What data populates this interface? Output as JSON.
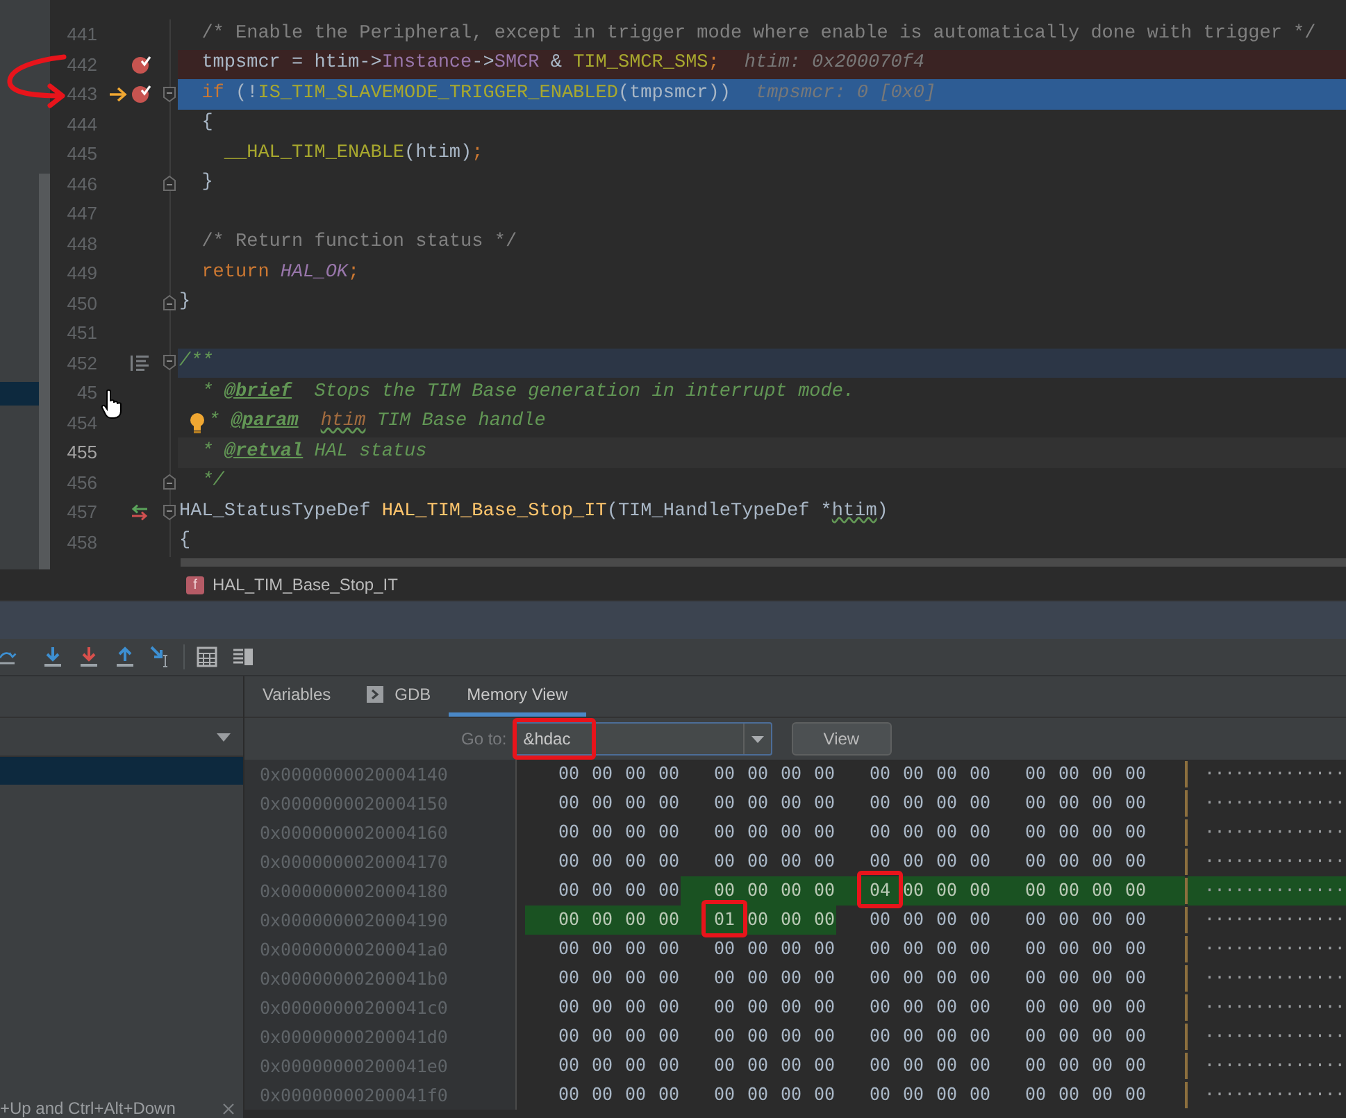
{
  "editor": {
    "annotation_arrow": true,
    "side_panel": {
      "rows": [
        {
          "selected": true
        }
      ]
    },
    "lines": [
      {
        "number": "441",
        "kind": "plain",
        "breakpoint": false,
        "execution": false,
        "highlighted": false,
        "current": false,
        "fold_start": false,
        "fold_end": false,
        "segments": [
          {
            "kind": "comment",
            "text": "  /* Enable the Peripheral, except in trigger mode where enable is automatically done with trigger */"
          }
        ]
      },
      {
        "number": "442",
        "kind": "plain",
        "breakpoint": true,
        "execution": false,
        "highlighted": false,
        "current": false,
        "fold_start": false,
        "fold_end": false,
        "segments": [
          {
            "kind": "plain",
            "text": "  tmpsmcr = htim->"
          },
          {
            "kind": "field",
            "text": "Instance"
          },
          {
            "kind": "plain",
            "text": "->"
          },
          {
            "kind": "field",
            "text": "SMCR"
          },
          {
            "kind": "plain",
            "text": " & "
          },
          {
            "kind": "macro",
            "text": "TIM_SMCR_SMS"
          },
          {
            "kind": "keyword",
            "text": ";"
          }
        ],
        "hint": "htim: 0x200070f4"
      },
      {
        "number": "443",
        "kind": "plain",
        "breakpoint": true,
        "execution": true,
        "highlighted": false,
        "current": false,
        "fold_start": true,
        "fold_end": false,
        "segments": [
          {
            "kind": "keyword",
            "text": "  if"
          },
          {
            "kind": "plain",
            "text": " (!"
          },
          {
            "kind": "macro",
            "text": "IS_TIM_SLAVEMODE_TRIGGER_ENABLED"
          },
          {
            "kind": "plain",
            "text": "(tmpsmcr))"
          }
        ],
        "hint": "tmpsmcr: 0 [0x0]"
      },
      {
        "number": "444",
        "kind": "plain",
        "breakpoint": false,
        "execution": false,
        "highlighted": false,
        "current": false,
        "fold_start": false,
        "fold_end": false,
        "segments": [
          {
            "kind": "plain",
            "text": "  {"
          }
        ]
      },
      {
        "number": "445",
        "kind": "plain",
        "breakpoint": false,
        "execution": false,
        "highlighted": false,
        "current": false,
        "fold_start": false,
        "fold_end": false,
        "segments": [
          {
            "kind": "macro",
            "text": "    __HAL_TIM_ENABLE"
          },
          {
            "kind": "plain",
            "text": "(htim)"
          },
          {
            "kind": "keyword",
            "text": ";"
          }
        ]
      },
      {
        "number": "446",
        "kind": "plain",
        "breakpoint": false,
        "execution": false,
        "highlighted": false,
        "current": false,
        "fold_start": false,
        "fold_end": true,
        "segments": [
          {
            "kind": "plain",
            "text": "  }"
          }
        ]
      },
      {
        "number": "447",
        "kind": "plain",
        "breakpoint": false,
        "execution": false,
        "highlighted": false,
        "current": false,
        "fold_start": false,
        "fold_end": false
      },
      {
        "number": "448",
        "kind": "plain",
        "breakpoint": false,
        "execution": false,
        "highlighted": false,
        "current": false,
        "fold_start": false,
        "fold_end": false,
        "segments": [
          {
            "kind": "comment",
            "text": "  /* Return function status */"
          }
        ]
      },
      {
        "number": "449",
        "kind": "plain",
        "breakpoint": false,
        "execution": false,
        "highlighted": false,
        "current": false,
        "fold_start": false,
        "fold_end": false,
        "segments": [
          {
            "kind": "keyword",
            "text": "  return "
          },
          {
            "kind": "constant",
            "text": "HAL_OK"
          },
          {
            "kind": "keyword",
            "text": ";"
          }
        ]
      },
      {
        "number": "450",
        "kind": "plain",
        "breakpoint": false,
        "execution": false,
        "highlighted": false,
        "current": false,
        "fold_start": false,
        "fold_end": true,
        "segments": [
          {
            "kind": "plain",
            "text": "}"
          }
        ]
      },
      {
        "number": "451",
        "kind": "plain",
        "breakpoint": false,
        "execution": false,
        "highlighted": false,
        "current": false,
        "fold_start": false,
        "fold_end": false
      },
      {
        "number": "452",
        "kind": "doc_toggle",
        "breakpoint": false,
        "execution": false,
        "highlighted": true,
        "current": false,
        "fold_start": true,
        "fold_end": false,
        "segments": [
          {
            "kind": "doc",
            "text": "/**"
          }
        ]
      },
      {
        "number": "45",
        "kind": "plain",
        "breakpoint": false,
        "execution": false,
        "highlighted": false,
        "current": false,
        "fold_start": false,
        "fold_end": false,
        "segments": [
          {
            "kind": "doc",
            "text": "  * "
          },
          {
            "kind": "doctag",
            "text": "@brief"
          },
          {
            "kind": "doc",
            "text": "  Stops the TIM Base generation in interrupt mode."
          }
        ]
      },
      {
        "number": "454",
        "kind": "bulb",
        "breakpoint": false,
        "execution": false,
        "highlighted": false,
        "current": false,
        "fold_start": false,
        "fold_end": false,
        "segments": [
          {
            "kind": "doc",
            "text": "* "
          },
          {
            "kind": "doctag",
            "text": "@param"
          },
          {
            "kind": "param",
            "text": "htim"
          },
          {
            "kind": "doc",
            "text": " TIM Base handle"
          }
        ]
      },
      {
        "number": "455",
        "kind": "plain",
        "breakpoint": false,
        "execution": false,
        "highlighted": false,
        "current": true,
        "fold_start": false,
        "fold_end": false,
        "segments": [
          {
            "kind": "doc",
            "text": "  * "
          },
          {
            "kind": "doctag",
            "text": "@retval"
          },
          {
            "kind": "doc",
            "text": " HAL status"
          }
        ]
      },
      {
        "number": "456",
        "kind": "plain",
        "breakpoint": false,
        "execution": false,
        "highlighted": false,
        "current": false,
        "fold_start": false,
        "fold_end": true,
        "segments": [
          {
            "kind": "doc",
            "text": "  */"
          }
        ]
      },
      {
        "number": "457",
        "kind": "implements",
        "breakpoint": false,
        "execution": false,
        "highlighted": false,
        "current": false,
        "fold_start": true,
        "fold_end": false,
        "segments": [
          {
            "kind": "plain",
            "text": "HAL_StatusTypeDef "
          },
          {
            "kind": "fndecl",
            "text": "HAL_TIM_Base_Stop_IT"
          },
          {
            "kind": "plain",
            "text": "(TIM_HandleTypeDef *"
          },
          {
            "kind": "underlined",
            "text": "htim"
          },
          {
            "kind": "plain",
            "text": ")"
          }
        ]
      },
      {
        "number": "458",
        "kind": "plain",
        "breakpoint": false,
        "execution": false,
        "highlighted": false,
        "current": false,
        "fold_start": false,
        "fold_end": false,
        "segments": [
          {
            "kind": "plain",
            "text": "{"
          }
        ]
      }
    ]
  },
  "breadcrumb": {
    "icon_text": "f",
    "label": "HAL_TIM_Base_Stop_IT"
  },
  "left_panel": {
    "rows": [
      {
        "selected": true
      }
    ],
    "hint": "+Up and Ctrl+Alt+Down"
  },
  "tabs": [
    {
      "label": "Variables",
      "kind": "plain",
      "selected": false
    },
    {
      "label": "GDB",
      "kind": "console",
      "selected": false
    },
    {
      "label": "Memory View",
      "kind": "plain",
      "selected": true
    }
  ],
  "goto": {
    "label": "Go to:",
    "value": "&hdac",
    "circled": true,
    "button": "View"
  },
  "memory": [
    {
      "address": "0x0000000020004140",
      "ascii_changed": false,
      "ascii": "··············",
      "groups": [
        {
          "bytes": [
            "00",
            "00",
            "00",
            "00"
          ],
          "changed": false,
          "first_circled": false
        },
        {
          "bytes": [
            "00",
            "00",
            "00",
            "00"
          ],
          "changed": false,
          "first_circled": false
        },
        {
          "bytes": [
            "00",
            "00",
            "00",
            "00"
          ],
          "changed": false,
          "first_circled": false
        },
        {
          "bytes": [
            "00",
            "00",
            "00",
            "00"
          ],
          "changed": false,
          "first_circled": false
        }
      ]
    },
    {
      "address": "0x0000000020004150",
      "ascii_changed": false,
      "ascii": "··············",
      "groups": [
        {
          "bytes": [
            "00",
            "00",
            "00",
            "00"
          ],
          "changed": false,
          "first_circled": false
        },
        {
          "bytes": [
            "00",
            "00",
            "00",
            "00"
          ],
          "changed": false,
          "first_circled": false
        },
        {
          "bytes": [
            "00",
            "00",
            "00",
            "00"
          ],
          "changed": false,
          "first_circled": false
        },
        {
          "bytes": [
            "00",
            "00",
            "00",
            "00"
          ],
          "changed": false,
          "first_circled": false
        }
      ]
    },
    {
      "address": "0x0000000020004160",
      "ascii_changed": false,
      "ascii": "··············",
      "groups": [
        {
          "bytes": [
            "00",
            "00",
            "00",
            "00"
          ],
          "changed": false,
          "first_circled": false
        },
        {
          "bytes": [
            "00",
            "00",
            "00",
            "00"
          ],
          "changed": false,
          "first_circled": false
        },
        {
          "bytes": [
            "00",
            "00",
            "00",
            "00"
          ],
          "changed": false,
          "first_circled": false
        },
        {
          "bytes": [
            "00",
            "00",
            "00",
            "00"
          ],
          "changed": false,
          "first_circled": false
        }
      ]
    },
    {
      "address": "0x0000000020004170",
      "ascii_changed": false,
      "ascii": "··············",
      "groups": [
        {
          "bytes": [
            "00",
            "00",
            "00",
            "00"
          ],
          "changed": false,
          "first_circled": false
        },
        {
          "bytes": [
            "00",
            "00",
            "00",
            "00"
          ],
          "changed": false,
          "first_circled": false
        },
        {
          "bytes": [
            "00",
            "00",
            "00",
            "00"
          ],
          "changed": false,
          "first_circled": false
        },
        {
          "bytes": [
            "00",
            "00",
            "00",
            "00"
          ],
          "changed": false,
          "first_circled": false
        }
      ]
    },
    {
      "address": "0x0000000020004180",
      "ascii_changed": true,
      "ascii": "··············",
      "groups": [
        {
          "bytes": [
            "00",
            "00",
            "00",
            "00"
          ],
          "changed": false,
          "first_circled": false
        },
        {
          "bytes": [
            "00",
            "00",
            "00",
            "00"
          ],
          "changed": true,
          "first_circled": false
        },
        {
          "bytes": [
            "04",
            "00",
            "00",
            "00"
          ],
          "changed": true,
          "first_circled": true
        },
        {
          "bytes": [
            "00",
            "00",
            "00",
            "00"
          ],
          "changed": true,
          "first_circled": false
        }
      ]
    },
    {
      "address": "0x0000000020004190",
      "ascii_changed": false,
      "ascii": "··············",
      "groups": [
        {
          "bytes": [
            "00",
            "00",
            "00",
            "00"
          ],
          "changed": true,
          "first_circled": false
        },
        {
          "bytes": [
            "01",
            "00",
            "00",
            "00"
          ],
          "changed": true,
          "first_circled": true
        },
        {
          "bytes": [
            "00",
            "00",
            "00",
            "00"
          ],
          "changed": false,
          "first_circled": false
        },
        {
          "bytes": [
            "00",
            "00",
            "00",
            "00"
          ],
          "changed": false,
          "first_circled": false
        }
      ]
    },
    {
      "address": "0x00000000200041a0",
      "ascii_changed": false,
      "ascii": "··············",
      "groups": [
        {
          "bytes": [
            "00",
            "00",
            "00",
            "00"
          ],
          "changed": false,
          "first_circled": false
        },
        {
          "bytes": [
            "00",
            "00",
            "00",
            "00"
          ],
          "changed": false,
          "first_circled": false
        },
        {
          "bytes": [
            "00",
            "00",
            "00",
            "00"
          ],
          "changed": false,
          "first_circled": false
        },
        {
          "bytes": [
            "00",
            "00",
            "00",
            "00"
          ],
          "changed": false,
          "first_circled": false
        }
      ]
    },
    {
      "address": "0x00000000200041b0",
      "ascii_changed": false,
      "ascii": "··············",
      "groups": [
        {
          "bytes": [
            "00",
            "00",
            "00",
            "00"
          ],
          "changed": false,
          "first_circled": false
        },
        {
          "bytes": [
            "00",
            "00",
            "00",
            "00"
          ],
          "changed": false,
          "first_circled": false
        },
        {
          "bytes": [
            "00",
            "00",
            "00",
            "00"
          ],
          "changed": false,
          "first_circled": false
        },
        {
          "bytes": [
            "00",
            "00",
            "00",
            "00"
          ],
          "changed": false,
          "first_circled": false
        }
      ]
    },
    {
      "address": "0x00000000200041c0",
      "ascii_changed": false,
      "ascii": "··············",
      "groups": [
        {
          "bytes": [
            "00",
            "00",
            "00",
            "00"
          ],
          "changed": false,
          "first_circled": false
        },
        {
          "bytes": [
            "00",
            "00",
            "00",
            "00"
          ],
          "changed": false,
          "first_circled": false
        },
        {
          "bytes": [
            "00",
            "00",
            "00",
            "00"
          ],
          "changed": false,
          "first_circled": false
        },
        {
          "bytes": [
            "00",
            "00",
            "00",
            "00"
          ],
          "changed": false,
          "first_circled": false
        }
      ]
    },
    {
      "address": "0x00000000200041d0",
      "ascii_changed": false,
      "ascii": "··············",
      "groups": [
        {
          "bytes": [
            "00",
            "00",
            "00",
            "00"
          ],
          "changed": false,
          "first_circled": false
        },
        {
          "bytes": [
            "00",
            "00",
            "00",
            "00"
          ],
          "changed": false,
          "first_circled": false
        },
        {
          "bytes": [
            "00",
            "00",
            "00",
            "00"
          ],
          "changed": false,
          "first_circled": false
        },
        {
          "bytes": [
            "00",
            "00",
            "00",
            "00"
          ],
          "changed": false,
          "first_circled": false
        }
      ]
    },
    {
      "address": "0x00000000200041e0",
      "ascii_changed": false,
      "ascii": "··············",
      "groups": [
        {
          "bytes": [
            "00",
            "00",
            "00",
            "00"
          ],
          "changed": false,
          "first_circled": false
        },
        {
          "bytes": [
            "00",
            "00",
            "00",
            "00"
          ],
          "changed": false,
          "first_circled": false
        },
        {
          "bytes": [
            "00",
            "00",
            "00",
            "00"
          ],
          "changed": false,
          "first_circled": false
        },
        {
          "bytes": [
            "00",
            "00",
            "00",
            "00"
          ],
          "changed": false,
          "first_circled": false
        }
      ]
    },
    {
      "address": "0x00000000200041f0",
      "ascii_changed": false,
      "ascii": "··············",
      "groups": [
        {
          "bytes": [
            "00",
            "00",
            "00",
            "00"
          ],
          "changed": false,
          "first_circled": false
        },
        {
          "bytes": [
            "00",
            "00",
            "00",
            "00"
          ],
          "changed": false,
          "first_circled": false
        },
        {
          "bytes": [
            "00",
            "00",
            "00",
            "00"
          ],
          "changed": false,
          "first_circled": false
        },
        {
          "bytes": [
            "00",
            "00",
            "00",
            "00"
          ],
          "changed": false,
          "first_circled": false
        }
      ]
    }
  ]
}
